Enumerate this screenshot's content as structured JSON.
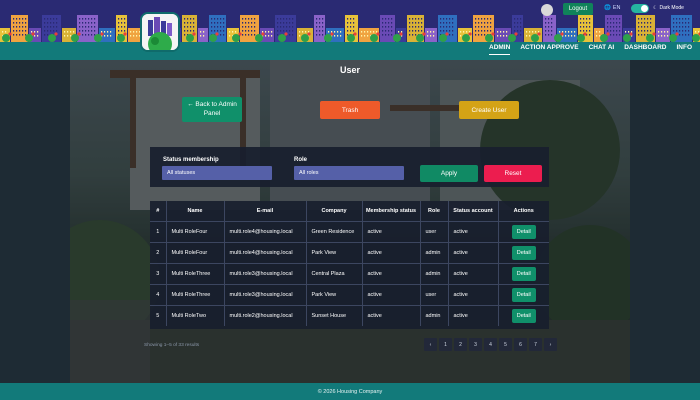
{
  "header": {
    "logout_label": "Logout",
    "language": "EN",
    "dark_mode_label": "Dark Mode"
  },
  "nav": {
    "items": [
      {
        "label": "ADMIN",
        "active": true
      },
      {
        "label": "ACTION APPROVE",
        "active": false
      },
      {
        "label": "CHAT AI",
        "active": false
      },
      {
        "label": "DASHBOARD",
        "active": false
      },
      {
        "label": "INFO",
        "active": false
      }
    ]
  },
  "page": {
    "title": "User",
    "back_label": "← Back to Admin Panel",
    "trash_label": "Trash",
    "create_label": "Create User"
  },
  "filters": {
    "membership_label": "Status membership",
    "membership_value": "All statuses",
    "role_label": "Role",
    "role_value": "All roles",
    "apply_label": "Apply",
    "reset_label": "Reset"
  },
  "table": {
    "headers": [
      "#",
      "Name",
      "E-mail",
      "Company",
      "Membership status",
      "Role",
      "Status account",
      "Actions"
    ],
    "rows": [
      {
        "num": "1",
        "name": "Multi RoleFour",
        "email": "multi.role4@housing.local",
        "company": "Green Residence",
        "membership": "active",
        "role": "user",
        "account": "active",
        "action": "Detail"
      },
      {
        "num": "2",
        "name": "Multi RoleFour",
        "email": "multi.role4@housing.local",
        "company": "Park View",
        "membership": "active",
        "role": "admin",
        "account": "active",
        "action": "Detail"
      },
      {
        "num": "3",
        "name": "Multi RoleThree",
        "email": "multi.role3@housing.local",
        "company": "Central Plaza",
        "membership": "active",
        "role": "admin",
        "account": "active",
        "action": "Detail"
      },
      {
        "num": "4",
        "name": "Multi RoleThree",
        "email": "multi.role3@housing.local",
        "company": "Park View",
        "membership": "active",
        "role": "user",
        "account": "active",
        "action": "Detail"
      },
      {
        "num": "5",
        "name": "Multi RoleTwo",
        "email": "multi.role2@housing.local",
        "company": "Sunset House",
        "membership": "active",
        "role": "admin",
        "account": "active",
        "action": "Detail"
      }
    ]
  },
  "pagination": {
    "summary": "Showing 1–5 of 33 results",
    "prev": "‹",
    "next": "›",
    "pages": [
      "1",
      "2",
      "3",
      "4",
      "5",
      "6",
      "7"
    ]
  },
  "footer": {
    "text": "© 2026 Housing Company"
  },
  "colors": {
    "banner_bg": "#2a2a73",
    "teal": "#127a7a",
    "green_button": "#10906a",
    "trash_button": "#ee5a2a",
    "create_button": "#d4a316",
    "reset_button": "#ec1d4f",
    "select_bg": "#5560a8"
  }
}
